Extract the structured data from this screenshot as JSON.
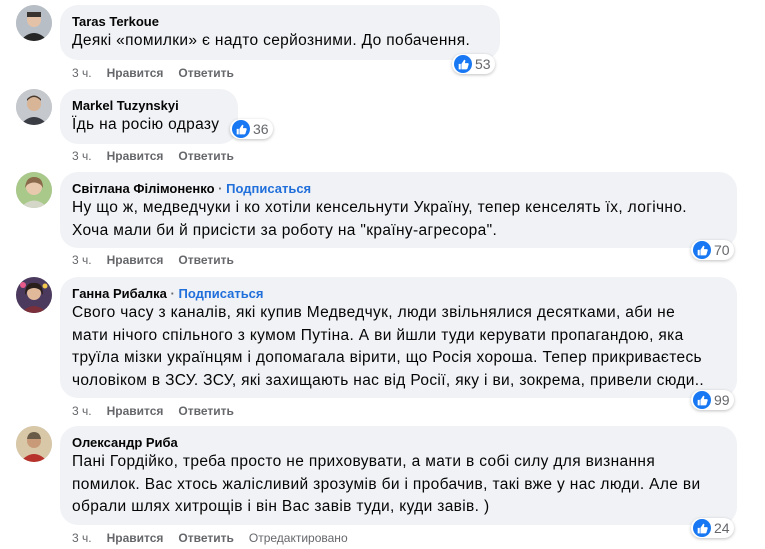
{
  "comments": [
    {
      "name": "Taras Terkoue",
      "follow": "",
      "lines": [
        "Деякі «помилки» є надто серйозними. До побачення."
      ],
      "likes": "53",
      "time": "3 ч.",
      "like_label": "Нравится",
      "reply_label": "Ответить",
      "edited": ""
    },
    {
      "name": "Markel Tuzynskyi",
      "follow": "",
      "lines": [
        "Їдь на росію одразу"
      ],
      "likes": "36",
      "time": "3 ч.",
      "like_label": "Нравится",
      "reply_label": "Ответить",
      "edited": ""
    },
    {
      "name": "Світлана Філімоненко",
      "follow": "Подписаться",
      "lines": [
        "Ну що ж, медведчуки і ко хотіли кенсельнути Україну, тепер кенселять їх, логічно.",
        "Хоча мали би й присісти за роботу на \"країну-агресора\"."
      ],
      "likes": "70",
      "time": "3 ч.",
      "like_label": "Нравится",
      "reply_label": "Ответить",
      "edited": ""
    },
    {
      "name": "Ганна Рибалка",
      "follow": "Подписаться",
      "lines": [
        "Свого часу з каналів, які купив Медведчук, люди звільнялися десятками, аби не",
        "мати нічого спільного з кумом Путіна. А ви йшли туди керувати пропагандою, яка",
        "труїла мізки українцям і допомагала вірити, що Росія хороша. Тепер прикриваєтесь",
        "чоловіком в ЗСУ. ЗСУ, які захищають нас від Росії, яку і ви, зокрема, привели сюди.."
      ],
      "likes": "99",
      "time": "3 ч.",
      "like_label": "Нравится",
      "reply_label": "Ответить",
      "edited": ""
    },
    {
      "name": "Олександр Риба",
      "follow": "",
      "lines": [
        "Пані Гордійко, треба просто не приховувати, а мати в собі силу для визнання",
        "помилок. Вас хтось жалісливий зрозумів би і пробачив, такі вже у нас люди. Але ви",
        "обрали шлях хитрощів і він Вас завів туди, куди завів. )"
      ],
      "likes": "24",
      "time": "3 ч.",
      "like_label": "Нравится",
      "reply_label": "Ответить",
      "edited": "Отредактировано"
    }
  ],
  "colors": {
    "bubble": "#f0f2f5",
    "meta": "#65676b",
    "follow": "#216fdb",
    "like": "#1877f2"
  },
  "icons": {
    "reaction": "like-thumb-icon"
  }
}
